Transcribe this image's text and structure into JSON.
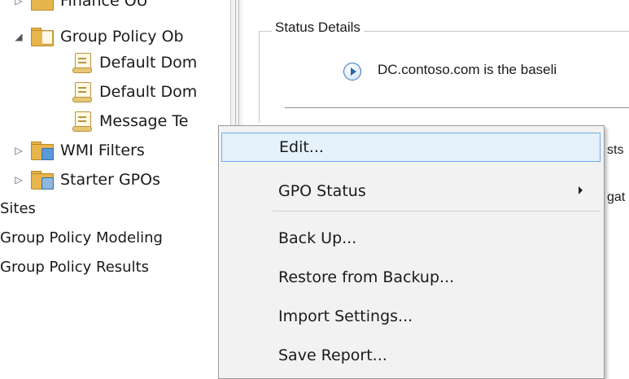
{
  "tree": {
    "top_partial": {
      "label": "Finance OU"
    },
    "gpo_folder": {
      "label": "Group Policy Ob",
      "expanded": true
    },
    "gpo_items": [
      {
        "label": "Default Dom"
      },
      {
        "label": "Default Dom"
      },
      {
        "label": "Message Te"
      }
    ],
    "wmi_filters": {
      "label": "WMI Filters"
    },
    "starter_gpos": {
      "label": "Starter GPOs"
    },
    "sites": {
      "label": "Sites"
    },
    "modeling": {
      "label": "Group Policy Modeling"
    },
    "results": {
      "label": "Group Policy Results"
    }
  },
  "details": {
    "status_title": "Status Details",
    "status_message": "DC.contoso.com is the baseli",
    "peek_line_1": "sts",
    "peek_line_2": "gat"
  },
  "context_menu": {
    "items": [
      {
        "label": "Edit...",
        "highlighted": true
      },
      {
        "label": "GPO Status",
        "submenu": true
      },
      {
        "label": "Back Up..."
      },
      {
        "label": "Restore from Backup..."
      },
      {
        "label": "Import Settings..."
      },
      {
        "label": "Save Report..."
      }
    ]
  },
  "colors": {
    "highlight_bg": "#e5f1fb",
    "highlight_border": "#6ab0e8",
    "menu_bg": "#f2f2f2",
    "folder": "#e8b54a"
  }
}
